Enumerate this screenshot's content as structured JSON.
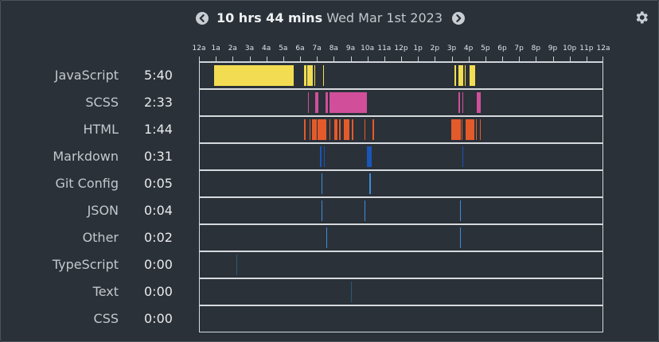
{
  "header": {
    "duration": "10 hrs 44 mins",
    "date": "Wed Mar 1st 2023"
  },
  "axis": {
    "start_hour": 0,
    "end_hour": 24,
    "labels": [
      "12a",
      "1a",
      "2a",
      "3a",
      "4a",
      "5a",
      "6a",
      "7a",
      "8a",
      "9a",
      "10a",
      "11a",
      "12p",
      "1p",
      "2p",
      "3p",
      "4p",
      "5p",
      "6p",
      "7p",
      "8p",
      "9p",
      "10p",
      "11p",
      "12a"
    ]
  },
  "chart_data": {
    "type": "timeline",
    "x_unit": "hour of day",
    "xlim": [
      0,
      24
    ],
    "series": [
      {
        "name": "JavaScript",
        "total": "5:40",
        "color": "#f2dd52",
        "segments": [
          [
            0.85,
            5.58
          ],
          [
            6.2,
            6.35
          ],
          [
            6.38,
            6.75
          ],
          [
            6.82,
            6.88
          ],
          [
            7.33,
            7.36
          ],
          [
            15.2,
            15.26
          ],
          [
            15.4,
            15.7
          ],
          [
            15.8,
            15.85
          ],
          [
            16.1,
            16.3
          ],
          [
            16.32,
            16.42
          ]
        ]
      },
      {
        "name": "SCSS",
        "total": "2:33",
        "color": "#d14f9a",
        "segments": [
          [
            6.45,
            6.5
          ],
          [
            6.88,
            7.05
          ],
          [
            7.5,
            7.65
          ],
          [
            7.75,
            9.95
          ],
          [
            15.4,
            15.5
          ],
          [
            15.65,
            15.7
          ],
          [
            16.5,
            16.72
          ]
        ]
      },
      {
        "name": "HTML",
        "total": "1:44",
        "color": "#e35b2b",
        "segments": [
          [
            6.2,
            6.32
          ],
          [
            6.55,
            6.6
          ],
          [
            6.7,
            6.95
          ],
          [
            7.0,
            7.55
          ],
          [
            7.75,
            7.8
          ],
          [
            8.0,
            8.2
          ],
          [
            8.3,
            8.4
          ],
          [
            8.6,
            8.9
          ],
          [
            9.05,
            9.15
          ],
          [
            9.8,
            9.85
          ],
          [
            10.3,
            10.4
          ],
          [
            15.0,
            15.55
          ],
          [
            15.6,
            15.65
          ],
          [
            15.85,
            16.35
          ],
          [
            16.45,
            16.5
          ],
          [
            16.7,
            16.75
          ]
        ]
      },
      {
        "name": "Markdown",
        "total": "0:31",
        "color": "#1a56b8",
        "segments": [
          [
            7.15,
            7.25
          ],
          [
            7.4,
            7.45
          ],
          [
            9.95,
            10.25
          ],
          [
            15.65,
            15.72
          ]
        ]
      },
      {
        "name": "Git Config",
        "total": "0:05",
        "color": "#3a8de0",
        "segments": [
          [
            7.25,
            7.3
          ],
          [
            10.12,
            10.22
          ]
        ]
      },
      {
        "name": "JSON",
        "total": "0:04",
        "color": "#3a8de0",
        "segments": [
          [
            7.25,
            7.28
          ],
          [
            9.8,
            9.83
          ],
          [
            15.5,
            15.58
          ]
        ]
      },
      {
        "name": "Other",
        "total": "0:02",
        "color": "#3a8de0",
        "segments": [
          [
            7.55,
            7.58
          ],
          [
            15.52,
            15.56
          ]
        ]
      },
      {
        "name": "TypeScript",
        "total": "0:00",
        "color": "#2a5a7a",
        "segments": [
          [
            2.2,
            2.25
          ]
        ]
      },
      {
        "name": "Text",
        "total": "0:00",
        "color": "#2a5a7a",
        "segments": [
          [
            9.0,
            9.04
          ]
        ]
      },
      {
        "name": "CSS",
        "total": "0:00",
        "color": "#2a5a7a",
        "segments": []
      }
    ]
  },
  "icons": {
    "prev": "chevron-left-circle-icon",
    "next": "chevron-right-circle-icon",
    "settings": "gear-icon"
  }
}
